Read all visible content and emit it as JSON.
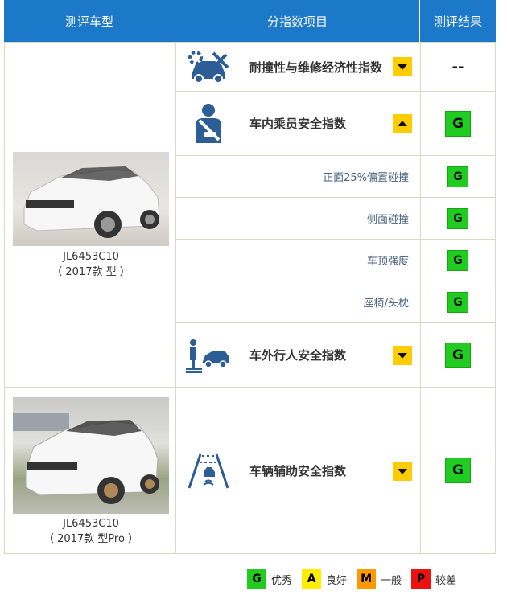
{
  "header": {
    "col1": "测评车型",
    "col2": "分指数项目",
    "col3": "测评结果"
  },
  "cars": [
    {
      "model": "JL6453C10",
      "year": "（ 2017款 型 ）"
    },
    {
      "model": "JL6453C10",
      "year": "（ 2017款 型Pro ）"
    }
  ],
  "rows": {
    "repair": {
      "label": "耐撞性与维修经济性指数",
      "result": "--",
      "toggle": "expand"
    },
    "occupant": {
      "label": "车内乘员安全指数",
      "result": "G",
      "toggle": "collapse"
    },
    "sub": [
      {
        "label": "正面25%偏置碰撞",
        "result": "G"
      },
      {
        "label": "侧面碰撞",
        "result": "G"
      },
      {
        "label": "车顶强度",
        "result": "G"
      },
      {
        "label": "座椅/头枕",
        "result": "G"
      }
    ],
    "pedestrian": {
      "label": "车外行人安全指数",
      "result": "G",
      "toggle": "expand"
    },
    "assist": {
      "label": "车辆辅助安全指数",
      "result": "G",
      "toggle": "expand"
    }
  },
  "legend": [
    {
      "grade": "G",
      "label": "优秀",
      "color": "#1fcc1f",
      "text": "#111111"
    },
    {
      "grade": "A",
      "label": "良好",
      "color": "#ffee00",
      "text": "#111111"
    },
    {
      "grade": "M",
      "label": "一般",
      "color": "#ff9900",
      "text": "#111111"
    },
    {
      "grade": "P",
      "label": "较差",
      "color": "#ee1111",
      "text": "#111111"
    }
  ],
  "colors": {
    "header": "#1c78c8",
    "grade_good": "#1fcc1f",
    "toggle": "#ffcc00",
    "icon": "#2d5d95"
  }
}
